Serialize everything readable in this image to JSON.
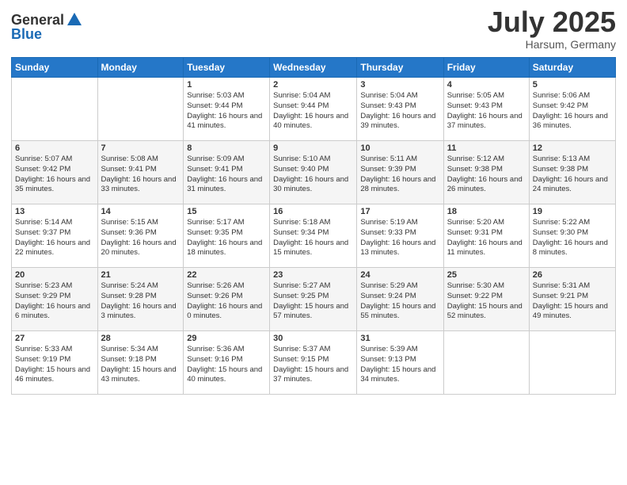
{
  "logo": {
    "general": "General",
    "blue": "Blue"
  },
  "title": {
    "month_year": "July 2025",
    "location": "Harsum, Germany"
  },
  "days_header": [
    "Sunday",
    "Monday",
    "Tuesday",
    "Wednesday",
    "Thursday",
    "Friday",
    "Saturday"
  ],
  "weeks": [
    [
      {
        "day": "",
        "info": ""
      },
      {
        "day": "",
        "info": ""
      },
      {
        "day": "1",
        "info": "Sunrise: 5:03 AM\nSunset: 9:44 PM\nDaylight: 16 hours and 41 minutes."
      },
      {
        "day": "2",
        "info": "Sunrise: 5:04 AM\nSunset: 9:44 PM\nDaylight: 16 hours and 40 minutes."
      },
      {
        "day": "3",
        "info": "Sunrise: 5:04 AM\nSunset: 9:43 PM\nDaylight: 16 hours and 39 minutes."
      },
      {
        "day": "4",
        "info": "Sunrise: 5:05 AM\nSunset: 9:43 PM\nDaylight: 16 hours and 37 minutes."
      },
      {
        "day": "5",
        "info": "Sunrise: 5:06 AM\nSunset: 9:42 PM\nDaylight: 16 hours and 36 minutes."
      }
    ],
    [
      {
        "day": "6",
        "info": "Sunrise: 5:07 AM\nSunset: 9:42 PM\nDaylight: 16 hours and 35 minutes."
      },
      {
        "day": "7",
        "info": "Sunrise: 5:08 AM\nSunset: 9:41 PM\nDaylight: 16 hours and 33 minutes."
      },
      {
        "day": "8",
        "info": "Sunrise: 5:09 AM\nSunset: 9:41 PM\nDaylight: 16 hours and 31 minutes."
      },
      {
        "day": "9",
        "info": "Sunrise: 5:10 AM\nSunset: 9:40 PM\nDaylight: 16 hours and 30 minutes."
      },
      {
        "day": "10",
        "info": "Sunrise: 5:11 AM\nSunset: 9:39 PM\nDaylight: 16 hours and 28 minutes."
      },
      {
        "day": "11",
        "info": "Sunrise: 5:12 AM\nSunset: 9:38 PM\nDaylight: 16 hours and 26 minutes."
      },
      {
        "day": "12",
        "info": "Sunrise: 5:13 AM\nSunset: 9:38 PM\nDaylight: 16 hours and 24 minutes."
      }
    ],
    [
      {
        "day": "13",
        "info": "Sunrise: 5:14 AM\nSunset: 9:37 PM\nDaylight: 16 hours and 22 minutes."
      },
      {
        "day": "14",
        "info": "Sunrise: 5:15 AM\nSunset: 9:36 PM\nDaylight: 16 hours and 20 minutes."
      },
      {
        "day": "15",
        "info": "Sunrise: 5:17 AM\nSunset: 9:35 PM\nDaylight: 16 hours and 18 minutes."
      },
      {
        "day": "16",
        "info": "Sunrise: 5:18 AM\nSunset: 9:34 PM\nDaylight: 16 hours and 15 minutes."
      },
      {
        "day": "17",
        "info": "Sunrise: 5:19 AM\nSunset: 9:33 PM\nDaylight: 16 hours and 13 minutes."
      },
      {
        "day": "18",
        "info": "Sunrise: 5:20 AM\nSunset: 9:31 PM\nDaylight: 16 hours and 11 minutes."
      },
      {
        "day": "19",
        "info": "Sunrise: 5:22 AM\nSunset: 9:30 PM\nDaylight: 16 hours and 8 minutes."
      }
    ],
    [
      {
        "day": "20",
        "info": "Sunrise: 5:23 AM\nSunset: 9:29 PM\nDaylight: 16 hours and 6 minutes."
      },
      {
        "day": "21",
        "info": "Sunrise: 5:24 AM\nSunset: 9:28 PM\nDaylight: 16 hours and 3 minutes."
      },
      {
        "day": "22",
        "info": "Sunrise: 5:26 AM\nSunset: 9:26 PM\nDaylight: 16 hours and 0 minutes."
      },
      {
        "day": "23",
        "info": "Sunrise: 5:27 AM\nSunset: 9:25 PM\nDaylight: 15 hours and 57 minutes."
      },
      {
        "day": "24",
        "info": "Sunrise: 5:29 AM\nSunset: 9:24 PM\nDaylight: 15 hours and 55 minutes."
      },
      {
        "day": "25",
        "info": "Sunrise: 5:30 AM\nSunset: 9:22 PM\nDaylight: 15 hours and 52 minutes."
      },
      {
        "day": "26",
        "info": "Sunrise: 5:31 AM\nSunset: 9:21 PM\nDaylight: 15 hours and 49 minutes."
      }
    ],
    [
      {
        "day": "27",
        "info": "Sunrise: 5:33 AM\nSunset: 9:19 PM\nDaylight: 15 hours and 46 minutes."
      },
      {
        "day": "28",
        "info": "Sunrise: 5:34 AM\nSunset: 9:18 PM\nDaylight: 15 hours and 43 minutes."
      },
      {
        "day": "29",
        "info": "Sunrise: 5:36 AM\nSunset: 9:16 PM\nDaylight: 15 hours and 40 minutes."
      },
      {
        "day": "30",
        "info": "Sunrise: 5:37 AM\nSunset: 9:15 PM\nDaylight: 15 hours and 37 minutes."
      },
      {
        "day": "31",
        "info": "Sunrise: 5:39 AM\nSunset: 9:13 PM\nDaylight: 15 hours and 34 minutes."
      },
      {
        "day": "",
        "info": ""
      },
      {
        "day": "",
        "info": ""
      }
    ]
  ]
}
